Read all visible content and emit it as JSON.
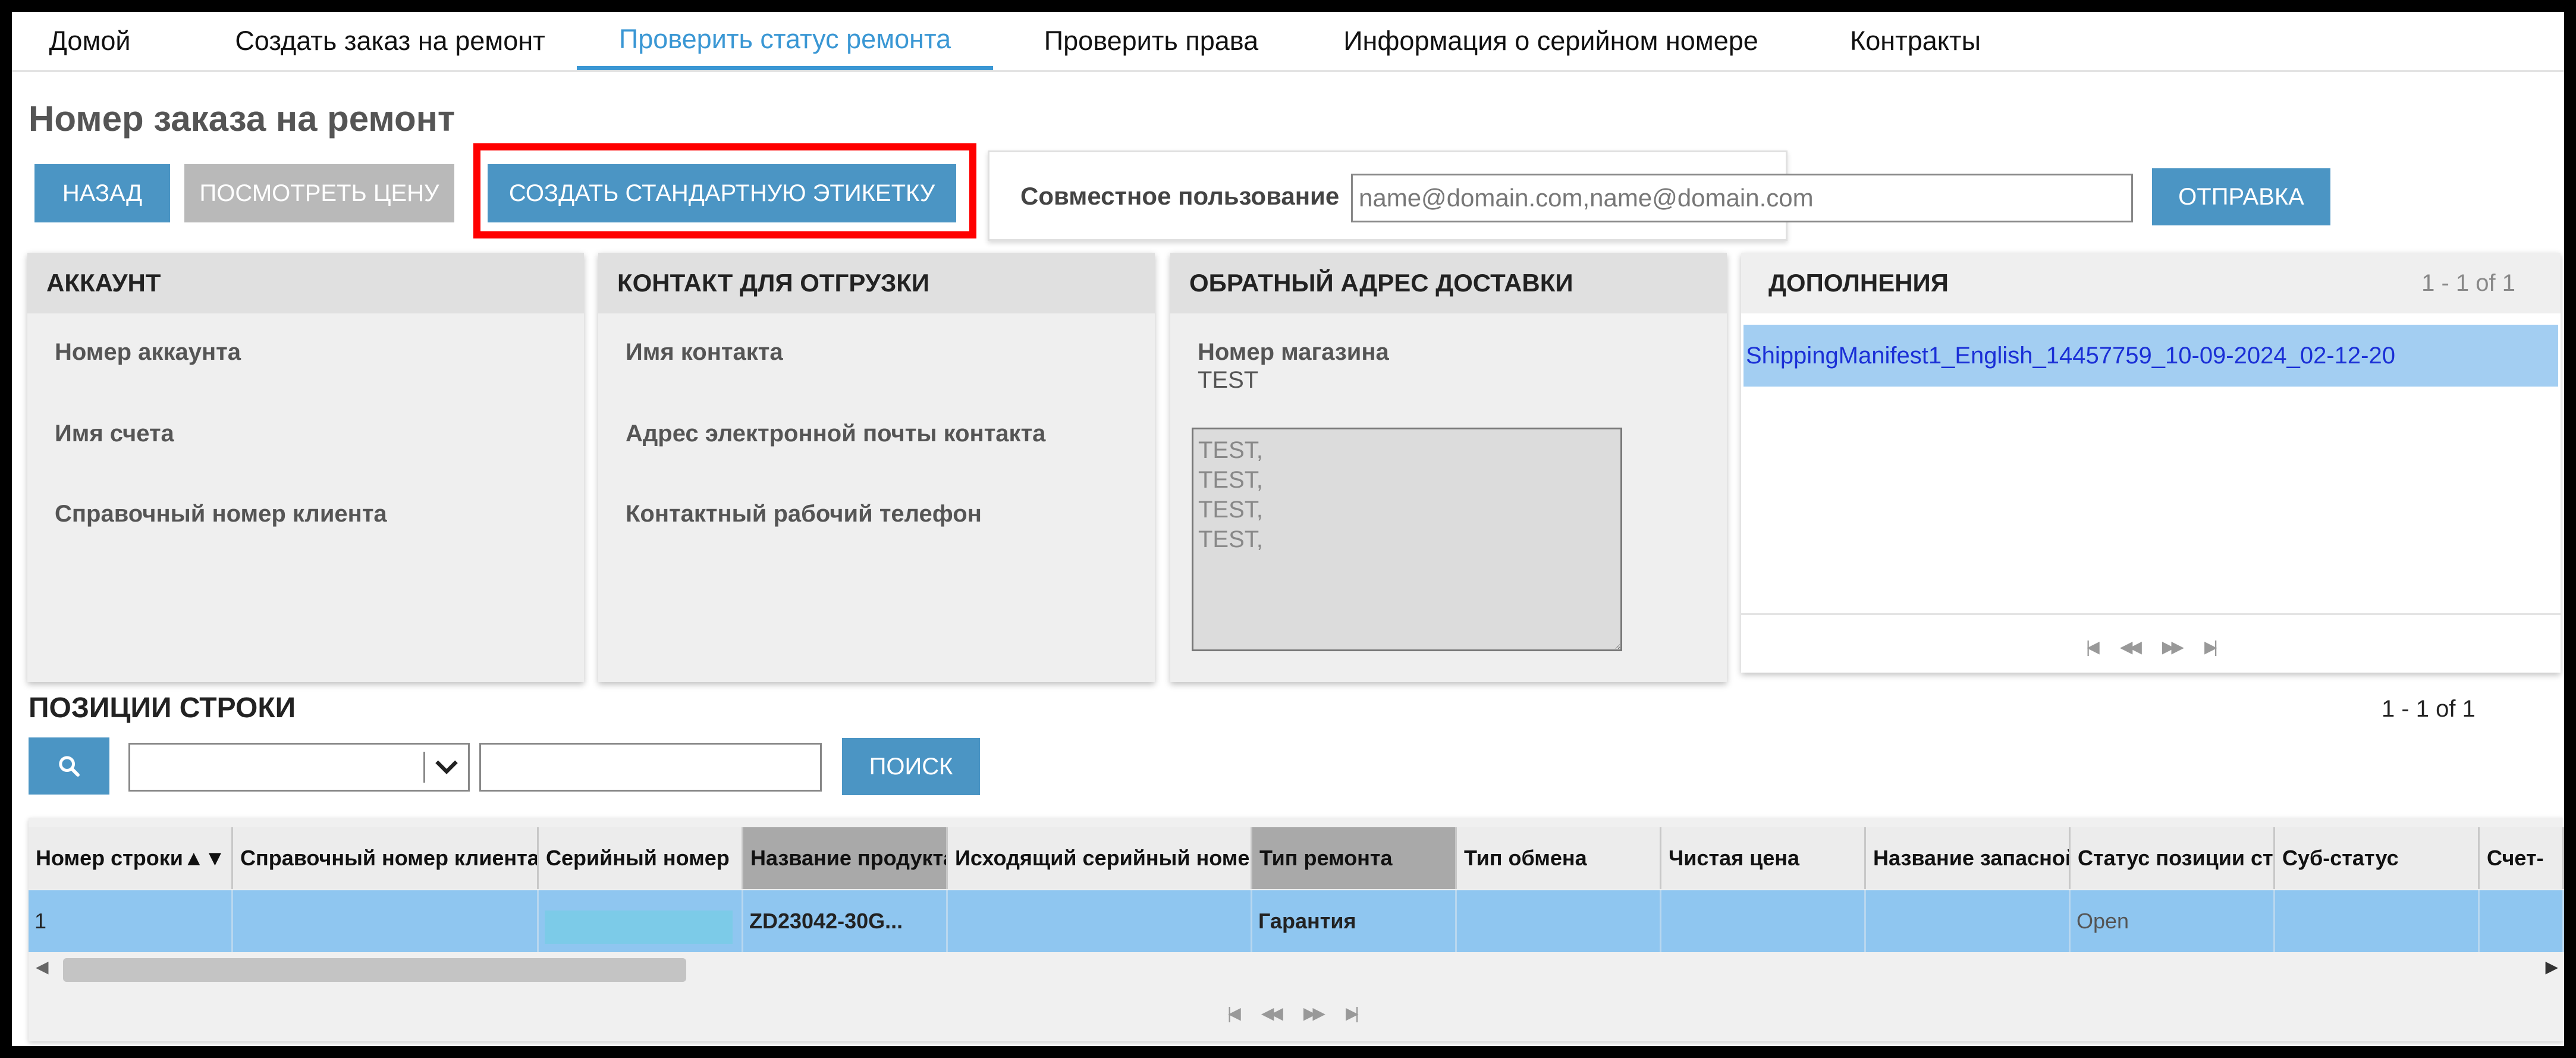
{
  "nav": {
    "items": [
      {
        "label": "Домой"
      },
      {
        "label": "Создать заказ на ремонт"
      },
      {
        "label": "Проверить статус ремонта",
        "active": true
      },
      {
        "label": "Проверить права"
      },
      {
        "label": "Информация о серийном номере"
      },
      {
        "label": "Контракты"
      }
    ]
  },
  "page": {
    "title": "Номер заказа на ремонт"
  },
  "toolbar": {
    "back_label": "НАЗАД",
    "view_price_label": "ПОСМОТРЕТЬ ЦЕНУ",
    "create_label_label": "СОЗДАТЬ СТАНДАРТНУЮ ЭТИКЕТКУ"
  },
  "share": {
    "label": "Совместное пользование",
    "placeholder": "name@domain.com,name@domain.com",
    "submit_label": "ОТПРАВКА"
  },
  "account": {
    "title": "АККАУНТ",
    "fields": [
      "Номер аккаунта",
      "Имя счета",
      "Справочный номер клиента"
    ]
  },
  "shipping_contact": {
    "title": "КОНТАКТ ДЛЯ ОТГРУЗКИ",
    "fields": [
      "Имя контакта",
      "Адрес электронной почты контакта",
      "Контактный рабочий телефон"
    ]
  },
  "return_address": {
    "title": "ОБРАТНЫЙ АДРЕС ДОСТАВКИ",
    "store_label": "Номер магазина",
    "store_value": "TEST",
    "address_text": "TEST,\nTEST,\nTEST,\nTEST,"
  },
  "attachments": {
    "title": "ДОПОЛНЕНИЯ",
    "count": "1 - 1 of 1",
    "items": [
      "ShippingManifest1_English_14457759_10-09-2024_02-12-20"
    ]
  },
  "line_items": {
    "title": "ПОЗИЦИИ СТРОКИ",
    "count": "1 - 1 of 1",
    "search_label": "ПОИСК",
    "columns": [
      "Номер строки",
      "Справочный номер клиента",
      "Серийный номер",
      "Название продукта",
      "Исходящий серийный номер",
      "Тип ремонта",
      "Тип обмена",
      "Чистая цена",
      "Название запасной",
      "Статус позиции ст",
      "Суб-статус",
      "Счет-"
    ],
    "sort_indicator": "▲▼",
    "rows": [
      {
        "line_no": "1",
        "product_name": "ZD23042-30G...",
        "repair_type": "Гарантия",
        "status": "Open"
      }
    ]
  },
  "icons": [
    "search-icon",
    "chevron-down-icon",
    "first-page-icon",
    "prev-page-icon",
    "next-page-icon",
    "last-page-icon",
    "scroll-left-icon",
    "scroll-right-icon"
  ]
}
